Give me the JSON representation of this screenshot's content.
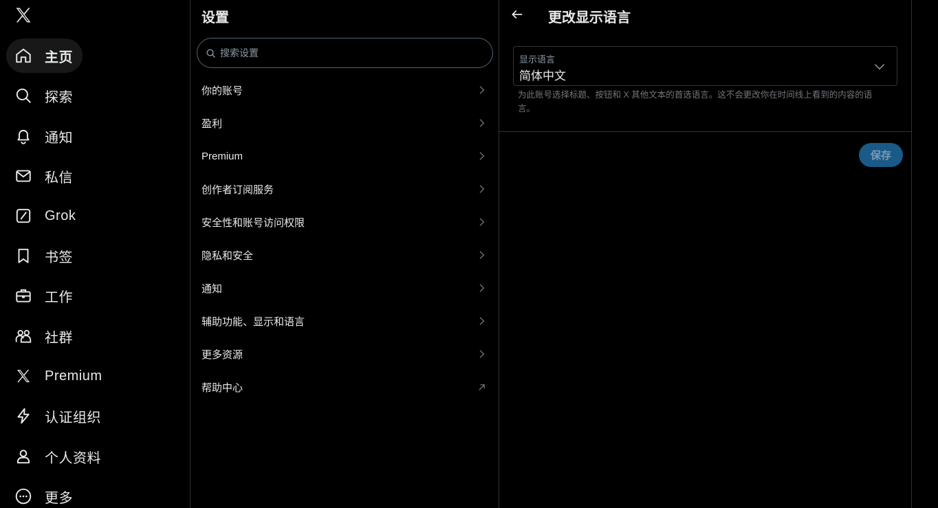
{
  "nav": {
    "items": [
      {
        "label": "主页",
        "icon": "home-icon"
      },
      {
        "label": "探索",
        "icon": "search-icon"
      },
      {
        "label": "通知",
        "icon": "bell-icon"
      },
      {
        "label": "私信",
        "icon": "mail-icon"
      },
      {
        "label": "Grok",
        "icon": "grok-icon"
      },
      {
        "label": "书签",
        "icon": "bookmark-icon"
      },
      {
        "label": "工作",
        "icon": "briefcase-icon"
      },
      {
        "label": "社群",
        "icon": "community-icon"
      },
      {
        "label": "Premium",
        "icon": "x-logo-icon"
      },
      {
        "label": "认证组织",
        "icon": "lightning-icon"
      },
      {
        "label": "个人资料",
        "icon": "person-icon"
      },
      {
        "label": "更多",
        "icon": "more-circle-icon"
      }
    ],
    "active": "主页"
  },
  "settings": {
    "title": "设置",
    "search_placeholder": "搜索设置",
    "items": [
      {
        "label": "你的账号",
        "icon": "chevron-right-icon"
      },
      {
        "label": "盈利",
        "icon": "chevron-right-icon"
      },
      {
        "label": "Premium",
        "icon": "chevron-right-icon"
      },
      {
        "label": "创作者订阅服务",
        "icon": "chevron-right-icon"
      },
      {
        "label": "安全性和账号访问权限",
        "icon": "chevron-right-icon"
      },
      {
        "label": "隐私和安全",
        "icon": "chevron-right-icon"
      },
      {
        "label": "通知",
        "icon": "chevron-right-icon"
      },
      {
        "label": "辅助功能、显示和语言",
        "icon": "chevron-right-icon"
      },
      {
        "label": "更多资源",
        "icon": "chevron-right-icon"
      },
      {
        "label": "帮助中心",
        "icon": "external-link-arrow-icon"
      }
    ]
  },
  "detail": {
    "title": "更改显示语言",
    "select_label": "显示语言",
    "select_value": "简体中文",
    "help": "为此账号选择标题、按钮和 X 其他文本的首选语言。这不会更改你在时间线上看到的内容的语言。",
    "save_label": "保存"
  },
  "colors": {
    "background": "#000000",
    "text": "#e7e9ea",
    "muted": "#71767b",
    "border": "#2f3336",
    "save_button": "#1a5a88"
  }
}
